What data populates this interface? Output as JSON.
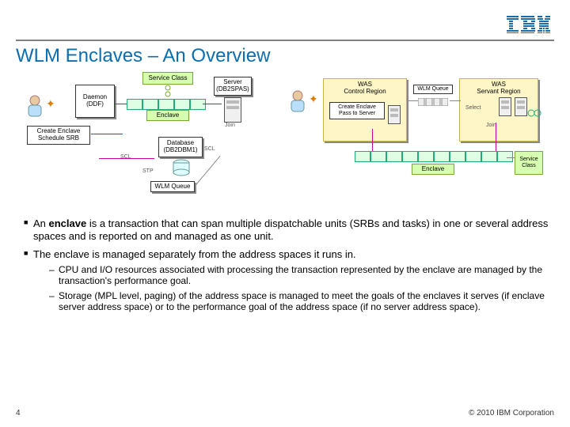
{
  "header": {
    "brand": "IBM"
  },
  "title": "WLM Enclaves – An Overview",
  "diagram": {
    "left": {
      "daemon": "Daemon\n(DDF)",
      "create": "Create Enclave\nSchedule SRB",
      "service_class": "Service Class",
      "enclave": "Enclave",
      "server": "Server\n(DB2SPAS)",
      "database": "Database\n(DB2DBM1)",
      "wlm_queue": "WLM Queue",
      "scl": "SCL",
      "stp": "STP",
      "join": "Join"
    },
    "right": {
      "was_control": "WAS\nControl Region",
      "create": "Create Enclave\nPass to Server",
      "wlm_queue": "WLM Queue",
      "was_servant": "WAS\nServant Region",
      "select": "Select",
      "join": "Join",
      "enclave": "Enclave",
      "service_class": "Service Class"
    }
  },
  "bullets": [
    {
      "prefix": "An ",
      "bold": "enclave",
      "rest": " is a transaction that can span multiple dispatchable units (SRBs and tasks) in one or several address spaces and is reported on and managed as one unit."
    },
    {
      "prefix": "",
      "bold": "",
      "rest": "The enclave is managed separately from the address spaces it runs in."
    }
  ],
  "subbullets": [
    "CPU and I/O resources associated with processing the transaction represented by the enclave are managed by the transaction's performance goal.",
    "Storage (MPL level, paging) of the address space is managed to meet the goals of the enclaves it serves (if enclave server address space) or to the performance goal of the address space (if no server address space)."
  ],
  "footer": {
    "page": "4",
    "copyright": "© 2010 IBM Corporation"
  }
}
